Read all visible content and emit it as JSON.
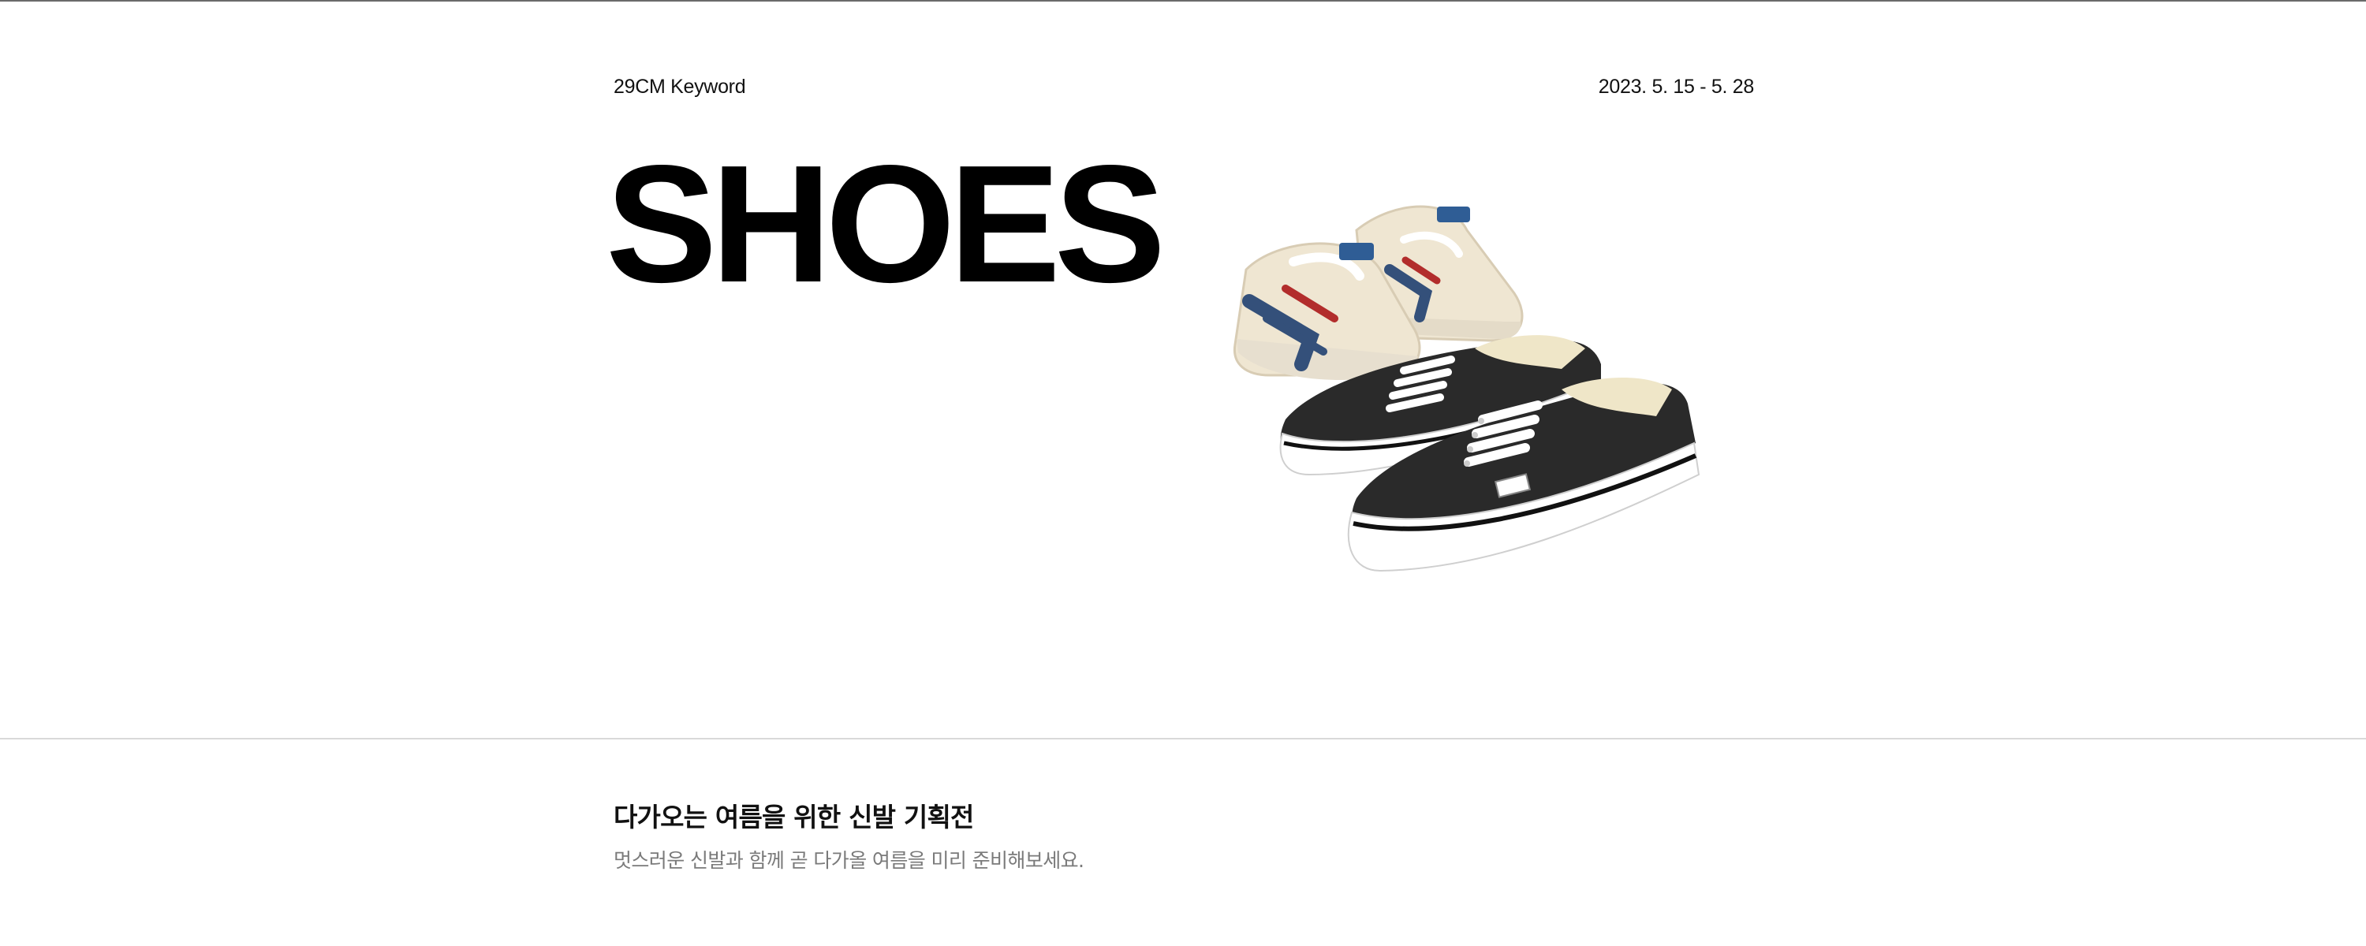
{
  "hero": {
    "keyword_label": "29CM Keyword",
    "date_range": "2023. 5. 15 - 5. 28",
    "title": "SHOES",
    "image": {
      "items": [
        "mesh-slip-on-sneakers-icon",
        "black-canvas-sneakers-icon"
      ],
      "colors": {
        "cream": "#efe6d2",
        "navy": "#34507a",
        "red": "#b22d2c",
        "black": "#2a2a2a",
        "white": "#ffffff"
      }
    }
  },
  "info": {
    "headline": "다가오는 여름을 위한 신발 기획전",
    "subline": "멋스러운 신발과 함께 곧 다가올 여름을 미리 준비해보세요."
  }
}
